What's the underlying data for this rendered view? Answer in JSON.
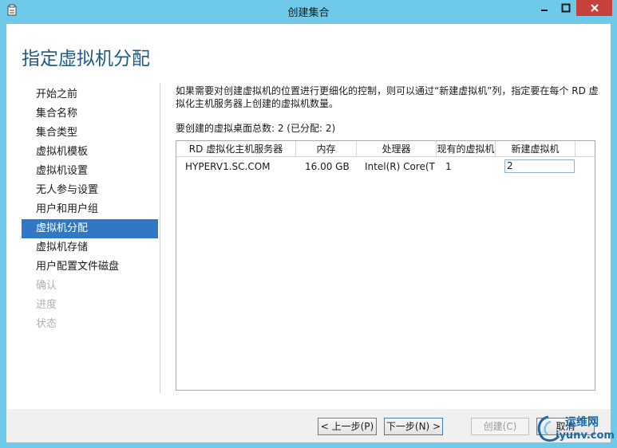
{
  "window": {
    "title": "创建集合"
  },
  "page": {
    "title": "指定虚拟机分配"
  },
  "nav": {
    "items": [
      {
        "label": "开始之前",
        "state": "normal"
      },
      {
        "label": "集合名称",
        "state": "normal"
      },
      {
        "label": "集合类型",
        "state": "normal"
      },
      {
        "label": "虚拟机模板",
        "state": "normal"
      },
      {
        "label": "虚拟机设置",
        "state": "normal"
      },
      {
        "label": "无人参与设置",
        "state": "normal"
      },
      {
        "label": "用户和用户组",
        "state": "normal"
      },
      {
        "label": "虚拟机分配",
        "state": "active"
      },
      {
        "label": "虚拟机存储",
        "state": "normal"
      },
      {
        "label": "用户配置文件磁盘",
        "state": "normal"
      },
      {
        "label": "确认",
        "state": "disabled"
      },
      {
        "label": "进度",
        "state": "disabled"
      },
      {
        "label": "状态",
        "state": "disabled"
      }
    ]
  },
  "main": {
    "description": "如果需要对创建虚拟机的位置进行更细化的控制，则可以通过“新建虚拟机”列，指定要在每个 RD 虚拟化主机服务器上创建的虚拟机数量。",
    "summary": "要创建的虚拟桌面总数: 2 (已分配: 2)",
    "table": {
      "columns": [
        "RD 虚拟化主机服务器",
        "内存",
        "处理器",
        "现有的虚拟机",
        "新建虚拟机"
      ],
      "rows": [
        {
          "server": "HYPERV1.SC.COM",
          "memory": "16.00 GB",
          "processor": "Intel(R) Core(TM",
          "existing": "1",
          "new": "2"
        }
      ]
    }
  },
  "footer": {
    "prev_label": "< 上一步(P)",
    "next_label": "下一步(N) >",
    "create_label": "创建(C)",
    "cancel_label": "取消"
  },
  "watermark": {
    "cn": "运维网",
    "en": "iyunv.com"
  },
  "colors": {
    "accent": "#2e78c6",
    "title": "#1e5c87",
    "chrome": "#6ecae8",
    "close": "#c6413a"
  }
}
